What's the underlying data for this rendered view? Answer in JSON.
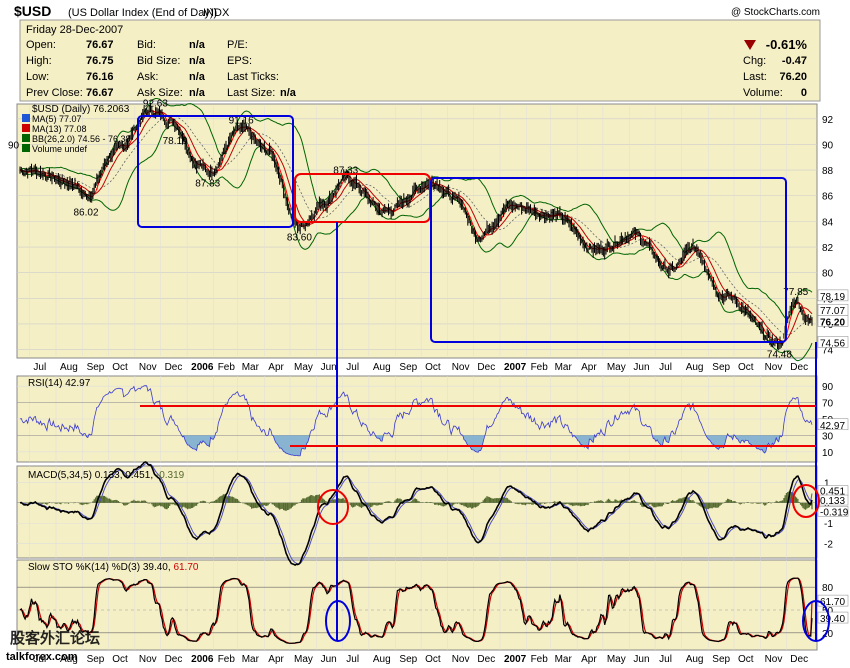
{
  "header": {
    "symbol": "$USD",
    "name": "(US Dollar Index (End of Day))",
    "exchange": "INDX",
    "copyright": "@ StockCharts.com"
  },
  "quote": {
    "date": "Friday   28-Dec-2007",
    "open_label": "Open:",
    "open": "76.67",
    "high_label": "High:",
    "high": "76.75",
    "low_label": "Low:",
    "low": "76.16",
    "prev_label": "Prev Close:",
    "prev": "76.67",
    "bid_label": "Bid:",
    "bid": "n/a",
    "bidsize_label": "Bid Size:",
    "bidsize": "n/a",
    "ask_label": "Ask:",
    "ask": "n/a",
    "asksize_label": "Ask Size:",
    "asksize": "n/a",
    "pe_label": "P/E:",
    "eps_label": "EPS:",
    "lastticks_label": "Last Ticks:",
    "lastsize_label": "Last Size:",
    "lastsize": "n/a",
    "change_pct": "-0.61%",
    "chg_label": "Chg:",
    "chg": "-0.47",
    "last_label": "Last:",
    "last": "76.20",
    "volume_label": "Volume:",
    "volume": "0"
  },
  "colors": {
    "panel_bg": "#f5efc6",
    "price_bar": "#000000",
    "ma5": "#ff0000",
    "ma13": "#c00000",
    "bollinger": "#006400",
    "rsi": "#3a3ad0",
    "macd": "#000000",
    "macd_signal": "#5050c0",
    "macd_hist": "#556b2f",
    "sto_k": "#000000",
    "sto_d": "#cc0000",
    "annotation_blue": "#0000dd",
    "annotation_red": "#ee0000"
  },
  "legend": {
    "price": "$USD (Daily) 76.2063",
    "ma5": "MA(5) 77.07",
    "ma13": "MA(13) 77.08",
    "bb": "BB(26,2.0) 74.56 - 76.38",
    "volume": "Volume undef"
  },
  "x_labels": [
    "Jul",
    "Aug",
    "Sep",
    "Oct",
    "Nov",
    "Dec",
    "2006",
    "Feb",
    "Mar",
    "Apr",
    "May",
    "Jun",
    "Jul",
    "Aug",
    "Sep",
    "Oct",
    "Nov",
    "Dec",
    "2007",
    "Feb",
    "Mar",
    "Apr",
    "May",
    "Jun",
    "Jul",
    "Aug",
    "Sep",
    "Oct",
    "Nov",
    "Dec"
  ],
  "watermark": "talkforex.com",
  "watermark_cn": "股客外汇论坛",
  "chart_data": [
    {
      "type": "line",
      "panel": "price",
      "title": "$USD (Daily) 76.2063",
      "ylim": [
        73.5,
        93
      ],
      "y_ticks": [
        "92",
        "90",
        "88",
        "86",
        "84",
        "82",
        "80",
        "78",
        "76",
        "74"
      ],
      "right_labels": [
        "78.19",
        "77.07",
        "76.20",
        "74.56"
      ],
      "left_label": "90",
      "annotations": [
        "86.02",
        "92.63",
        "78.19",
        "91.16",
        "87.83",
        "83.60",
        "87.33",
        "77.85",
        "74.48"
      ],
      "keypoints": [
        {
          "x": "2005-07-01",
          "y": 88.0
        },
        {
          "x": "2005-08-20",
          "y": 87.0
        },
        {
          "x": "2005-09-05",
          "y": 86.02
        },
        {
          "x": "2005-10-10",
          "y": 89.5
        },
        {
          "x": "2005-11-20",
          "y": 92.63
        },
        {
          "x": "2005-12-15",
          "y": 91.8
        },
        {
          "x": "2006-01-15",
          "y": 88.5
        },
        {
          "x": "2006-01-25",
          "y": 87.83
        },
        {
          "x": "2006-03-05",
          "y": 91.16
        },
        {
          "x": "2006-04-05",
          "y": 89.5
        },
        {
          "x": "2006-05-12",
          "y": 83.6
        },
        {
          "x": "2006-06-10",
          "y": 85.5
        },
        {
          "x": "2006-07-05",
          "y": 87.33
        },
        {
          "x": "2006-08-20",
          "y": 84.8
        },
        {
          "x": "2006-10-15",
          "y": 87.1
        },
        {
          "x": "2006-11-15",
          "y": 85.5
        },
        {
          "x": "2006-12-05",
          "y": 82.9
        },
        {
          "x": "2007-01-15",
          "y": 85.2
        },
        {
          "x": "2007-03-05",
          "y": 84.5
        },
        {
          "x": "2007-04-25",
          "y": 81.8
        },
        {
          "x": "2007-06-05",
          "y": 83.0
        },
        {
          "x": "2007-07-20",
          "y": 80.2
        },
        {
          "x": "2007-08-15",
          "y": 81.9
        },
        {
          "x": "2007-09-20",
          "y": 78.2
        },
        {
          "x": "2007-11-23",
          "y": 74.48
        },
        {
          "x": "2007-12-12",
          "y": 77.85
        },
        {
          "x": "2007-12-28",
          "y": 76.2
        }
      ]
    },
    {
      "type": "line",
      "panel": "rsi",
      "title": "RSI(14) 42.97",
      "ylim": [
        0,
        100
      ],
      "y_ticks": [
        "90",
        "70",
        "50",
        "30",
        "10"
      ],
      "right_label": "42.97",
      "last": 42.97
    },
    {
      "type": "line",
      "panel": "macd",
      "title": "MACD(5,34,5) 0.133, 0.451, -0.319",
      "series": [
        "0.133",
        "0.451",
        "-0.319"
      ],
      "ylim": [
        -2.6,
        1.6
      ],
      "y_ticks": [
        "1",
        "0",
        "-1",
        "-2"
      ],
      "right_labels": [
        "0.451",
        "0.133",
        "-0.319"
      ]
    },
    {
      "type": "line",
      "panel": "stochastic",
      "title": "Slow STO %K(14) %D(3) 39.40, 61.70",
      "series": [
        "39.40",
        "61.70"
      ],
      "ylim": [
        0,
        100
      ],
      "y_ticks": [
        "80",
        "50",
        "20"
      ],
      "right_labels": [
        "61.70",
        "39.40"
      ]
    }
  ]
}
